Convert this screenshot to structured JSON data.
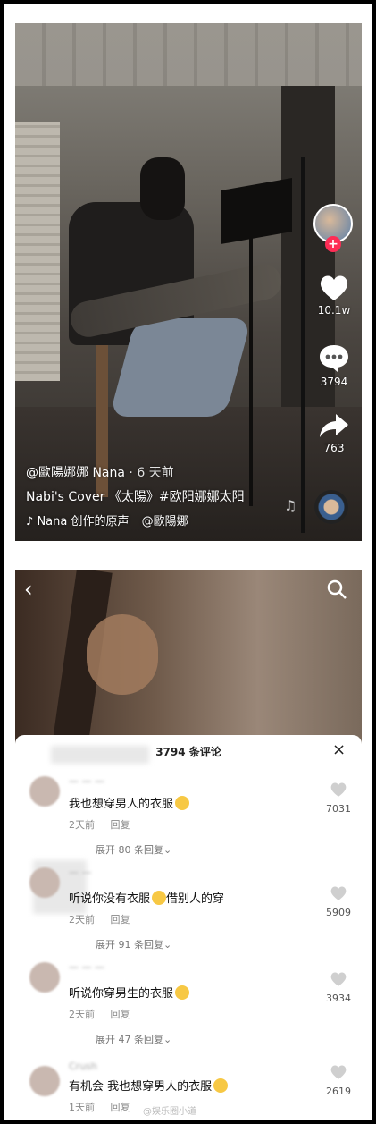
{
  "video": {
    "like_count": "10.1w",
    "comment_count": "3794",
    "share_count": "763",
    "author_line": "@歐陽娜娜 Nana",
    "time_ago": "· 6 天前",
    "description": "Nabi's Cover 《太陽》#欧阳娜娜太阳",
    "music": "Nana 创作的原声",
    "music_author": "@歐陽娜"
  },
  "comments_panel": {
    "title": "3794 条评论",
    "close": "×",
    "reply_label": "回复",
    "comments": [
      {
        "name": "一 一 一",
        "text": "我也想穿男人的衣服",
        "time": "2天前",
        "expand": "展开 80 条回复",
        "likes": "7031"
      },
      {
        "name": "一 一 ",
        "text": "听说你没有衣服",
        "text2": "借别人的穿",
        "time": "2天前",
        "expand": "展开 91 条回复",
        "likes": "5909"
      },
      {
        "name": "一 一 一",
        "text": "听说你穿男生的衣服",
        "time": "2天前",
        "expand": "展开 47 条回复",
        "likes": "3934"
      },
      {
        "name": "Crush",
        "text": "有机会 我也想穿男人的衣服",
        "time": "1天前",
        "likes": "2619"
      }
    ]
  },
  "watermark": "@娱乐圈小道"
}
